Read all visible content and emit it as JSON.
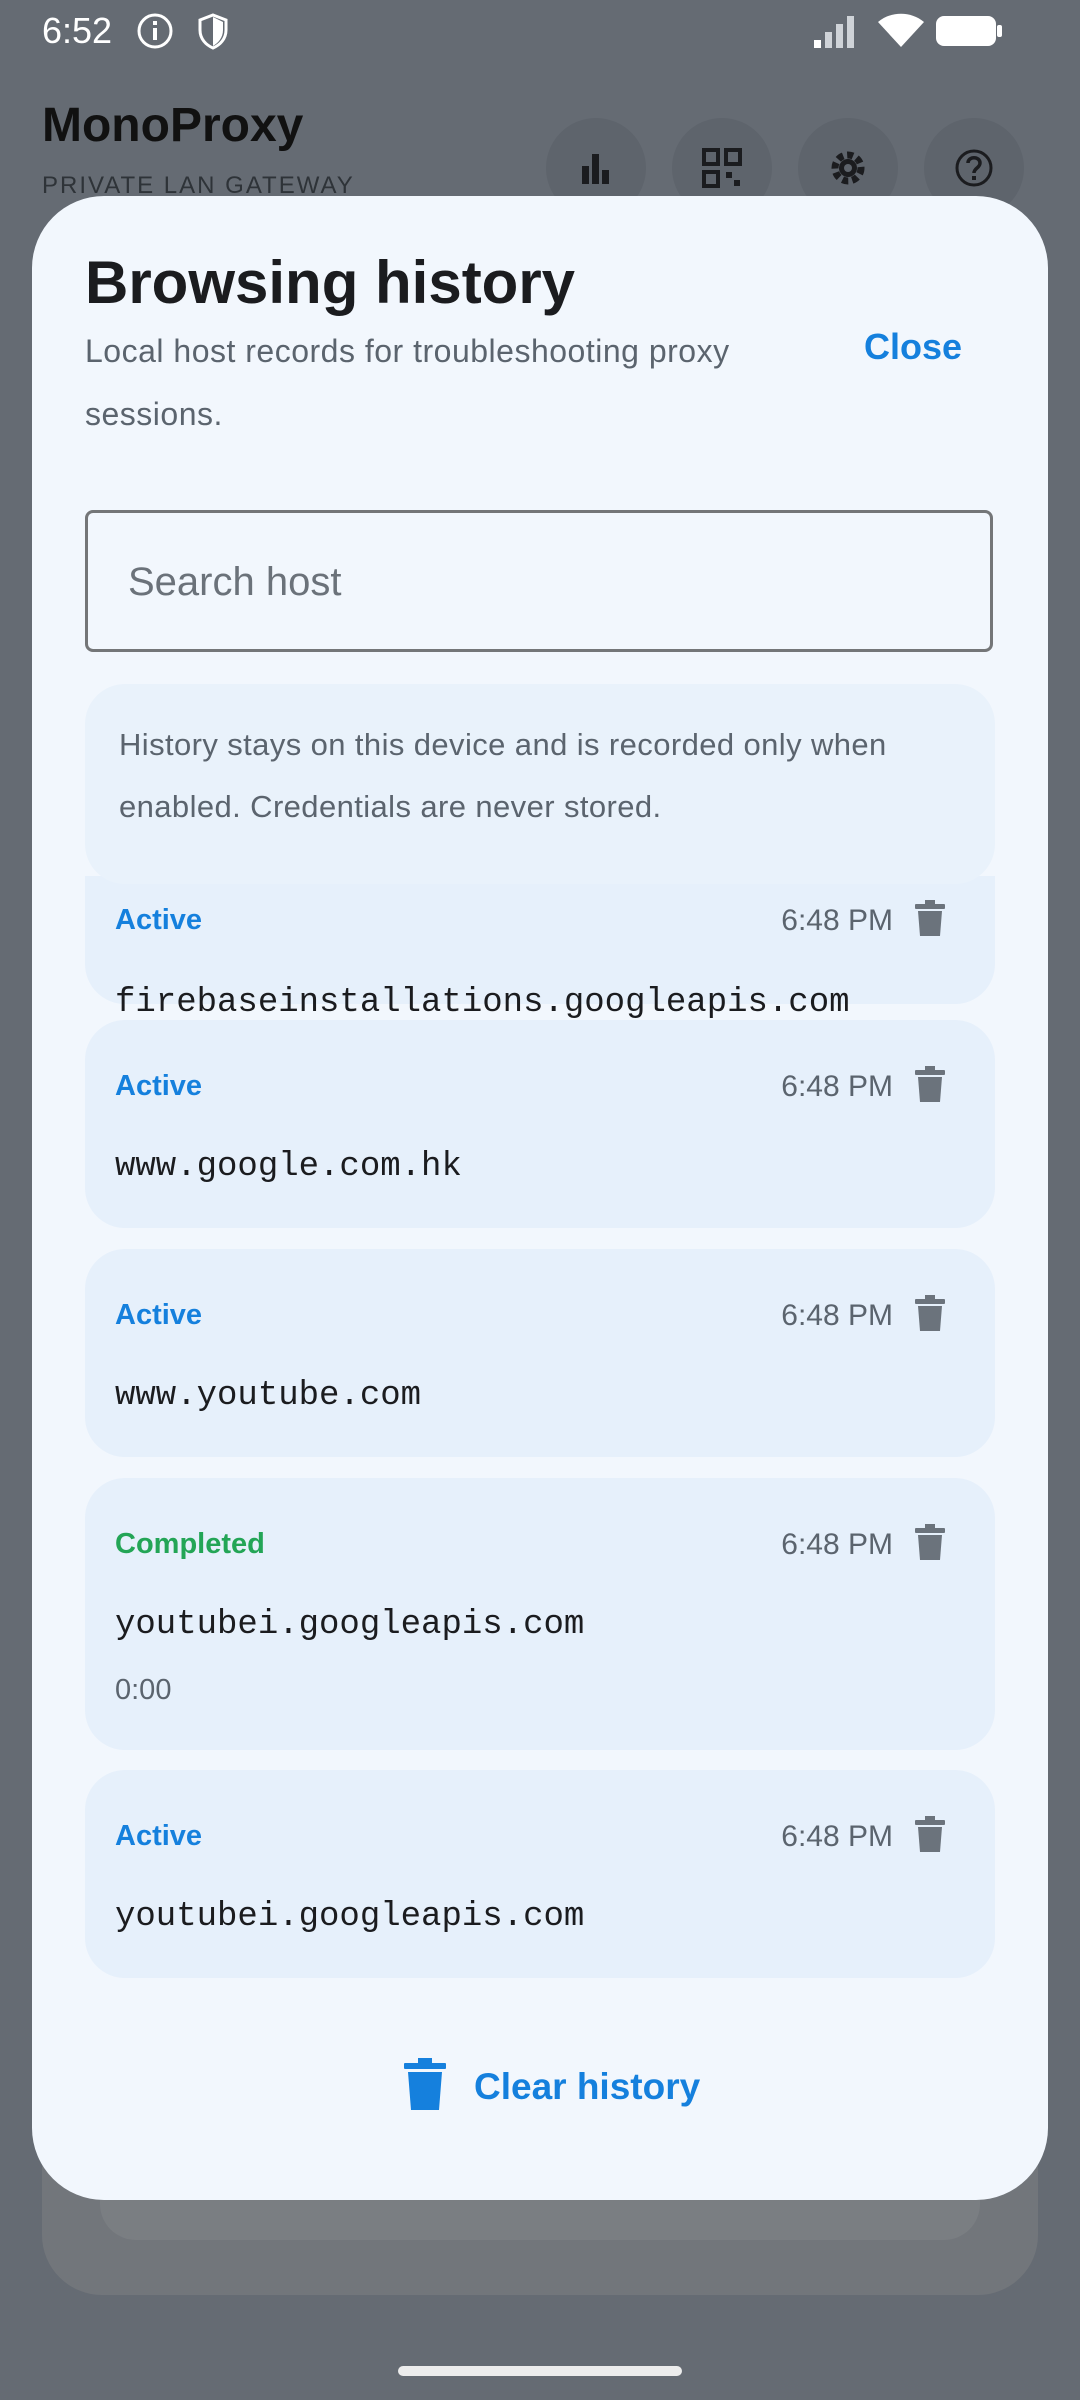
{
  "status_bar": {
    "time": "6:52"
  },
  "app": {
    "title": "MonoProxy",
    "subtitle": "PRIVATE LAN GATEWAY"
  },
  "sheet": {
    "title": "Browsing history",
    "subtitle": "Local host records for troubleshooting proxy sessions.",
    "close_label": "Close",
    "search_placeholder": "Search host",
    "info": "History stays on this device and is recorded only when enabled. Credentials are never stored.",
    "items": [
      {
        "status": "Active",
        "time": "6:48 PM",
        "host": "firebaseinstallations.googleapis.com"
      },
      {
        "status": "Active",
        "time": "6:48 PM",
        "host": "www.google.com.hk"
      },
      {
        "status": "Active",
        "time": "6:48 PM",
        "host": "www.youtube.com"
      },
      {
        "status": "Completed",
        "time": "6:48 PM",
        "host": "youtubei.googleapis.com",
        "duration": "0:00"
      },
      {
        "status": "Active",
        "time": "6:48 PM",
        "host": "youtubei.googleapis.com"
      }
    ],
    "clear_label": "Clear history"
  },
  "colors": {
    "active": "#1580dd",
    "completed": "#23a556",
    "accent": "#1580dd"
  }
}
